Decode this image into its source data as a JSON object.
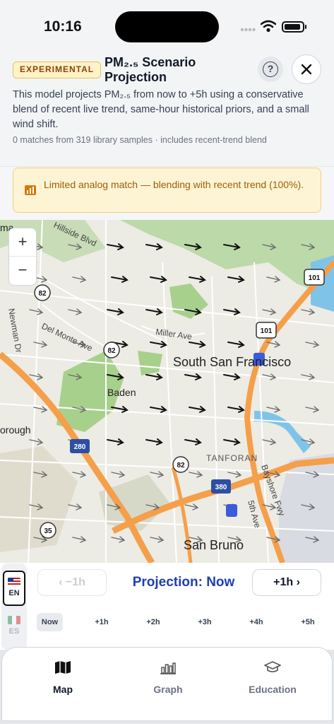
{
  "status_bar": {
    "time": "10:16"
  },
  "header": {
    "badge": "EXPERIMENTAL",
    "title": "PM₂.₅ Scenario Projection",
    "description": "This model projects PM₂.₅ from now to +5h using a conservative blend of recent live trend, same-hour historical priors, and a small wind shift.",
    "meta": "0 matches from 319 library samples · includes recent-trend blend"
  },
  "alert": {
    "text": "Limited analog match — blending with recent trend (100%)."
  },
  "map": {
    "labels": {
      "south_sf": "South San Francisco",
      "baden": "Baden",
      "san_bruno": "San Bruno",
      "tanforan": "TANFORAN",
      "hillside": "Hillside Blvd",
      "miller": "Miller Ave",
      "del_monte": "Del Monte Ave",
      "newman": "Newman Dr",
      "bayshore": "Bayshore Fwy",
      "fifth_ave": "5th Ave",
      "orough": "orough",
      "ma": "ma"
    },
    "shields": {
      "r82a": "82",
      "r82b": "82",
      "r82c": "82",
      "r101a": "101",
      "r101b": "101",
      "r280": "280",
      "r380": "380",
      "r35": "35"
    }
  },
  "language": {
    "en_label": "EN",
    "es_label": "ES",
    "selected": "EN"
  },
  "timeline": {
    "prev_label": "−1h",
    "title": "Projection: Now",
    "next_label": "+1h",
    "steps": [
      "Now",
      "+1h",
      "+2h",
      "+3h",
      "+4h",
      "+5h"
    ],
    "selected_step": "Now"
  },
  "nav": {
    "tabs": [
      {
        "label": "Map",
        "icon": "map-icon"
      },
      {
        "label": "Graph",
        "icon": "bar-chart-icon"
      },
      {
        "label": "Education",
        "icon": "graduation-cap-icon"
      }
    ],
    "active": "Map"
  },
  "colors": {
    "accent": "#1e40af",
    "warning_bg": "#fdf4d4",
    "warning_text": "#a15c07",
    "highway": "#f59f4a"
  }
}
